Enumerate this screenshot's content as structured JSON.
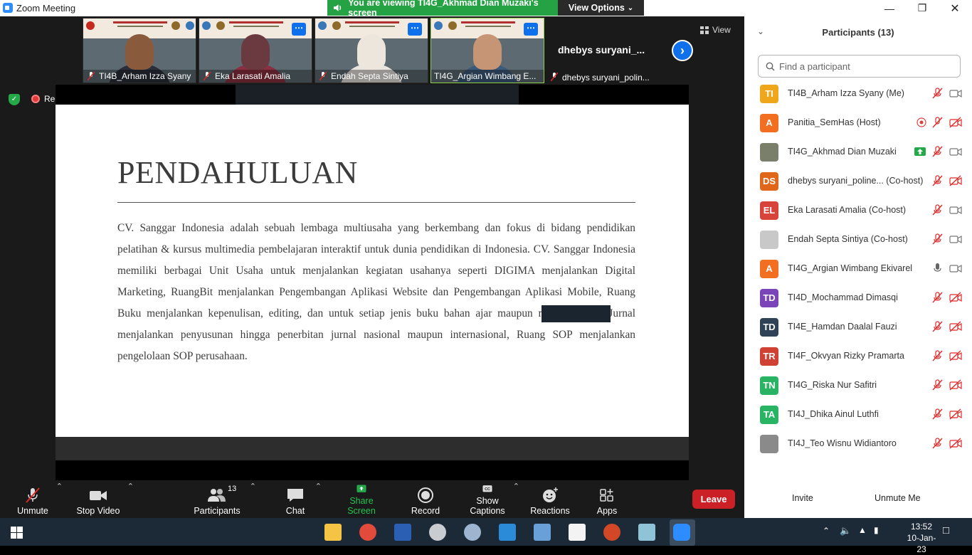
{
  "window": {
    "title": "Zoom Meeting"
  },
  "banner": {
    "viewing_text": "You are viewing TI4G_Akhmad Dian Muzaki's screen",
    "view_options": "View Options"
  },
  "top_view_label": "View",
  "recording_label": "Recording",
  "thumbnails": [
    {
      "name": "TI4B_Arham Izza Syany"
    },
    {
      "name": "Eka Larasati Amalia"
    },
    {
      "name": "Endah Septa Sintiya"
    },
    {
      "name": "TI4G_Argian Wimbang E..."
    },
    {
      "big_name": "dhebys  suryani_...",
      "name": "dhebys suryani_polin..."
    }
  ],
  "slide": {
    "title": "PENDAHULUAN",
    "body": "CV. Sanggar Indonesia adalah sebuah lembaga multiusaha yang berkembang dan fokus di bidang pendidikan pelatihan & kursus multimedia pembelajaran interaktif untuk dunia pendidikan di Indonesia. CV. Sanggar Indonesia memiliki berbagai Unit Usaha untuk menjalankan kegiatan usahanya seperti DIGIMA menjalankan Digital Marketing, RuangBit menjalankan Pengembangan Aplikasi Website dan Pengembangan Aplikasi Mobile, Ruang Buku menjalankan kepenulisan, editing, dan untuk setiap jenis buku bahan ajar maupun modul, Ruang Jurnal menjalankan penyusunan hingga penerbitan jurnal nasional maupun internasional, Ruang SOP menjalankan pengelolaan SOP perusahaan."
  },
  "toolbar": {
    "unmute": "Unmute",
    "stop_video": "Stop Video",
    "participants": "Participants",
    "participants_count": "13",
    "chat": "Chat",
    "share_screen": "Share Screen",
    "record": "Record",
    "show_captions": "Show Captions",
    "reactions": "Reactions",
    "apps": "Apps",
    "leave": "Leave"
  },
  "panel": {
    "title": "Participants (13)",
    "search_placeholder": "Find a participant",
    "participants": [
      {
        "initials": "TI",
        "color": "#f0a61a",
        "name": "TI4B_Arham Izza Syany (Me)"
      },
      {
        "initials": "A",
        "color": "#f26f21",
        "name": "Panitia_SemHas (Host)"
      },
      {
        "initials": "",
        "color": "#7a7f6c",
        "name": "TI4G_Akhmad Dian Muzaki"
      },
      {
        "initials": "DS",
        "color": "#e0671a",
        "name": "dhebys suryani_poline...  (Co-host)"
      },
      {
        "initials": "EL",
        "color": "#d9443a",
        "name": "Eka Larasati Amalia (Co-host)"
      },
      {
        "initials": "",
        "color": "#c8c8c8",
        "name": "Endah Septa Sintiya (Co-host)"
      },
      {
        "initials": "A",
        "color": "#f26f21",
        "name": "TI4G_Argian Wimbang Ekivarel"
      },
      {
        "initials": "TD",
        "color": "#7b44b8",
        "name": "TI4D_Mochammad Dimasqi"
      },
      {
        "initials": "TD",
        "color": "#2f4256",
        "name": "TI4E_Hamdan Daalal Fauzi"
      },
      {
        "initials": "TR",
        "color": "#d04134",
        "name": "TI4F_Okvyan Rizky Pramarta"
      },
      {
        "initials": "TN",
        "color": "#28b463",
        "name": "TI4G_Riska Nur Safitri"
      },
      {
        "initials": "TA",
        "color": "#28b463",
        "name": "TI4J_Dhika Ainul Luthfi"
      },
      {
        "initials": "",
        "color": "#8a8a8a",
        "name": "TI4J_Teo Wisnu Widiantoro"
      }
    ],
    "invite": "Invite",
    "unmute_me": "Unmute Me"
  },
  "clock": {
    "time": "13:52",
    "date": "10-Jan-23"
  }
}
